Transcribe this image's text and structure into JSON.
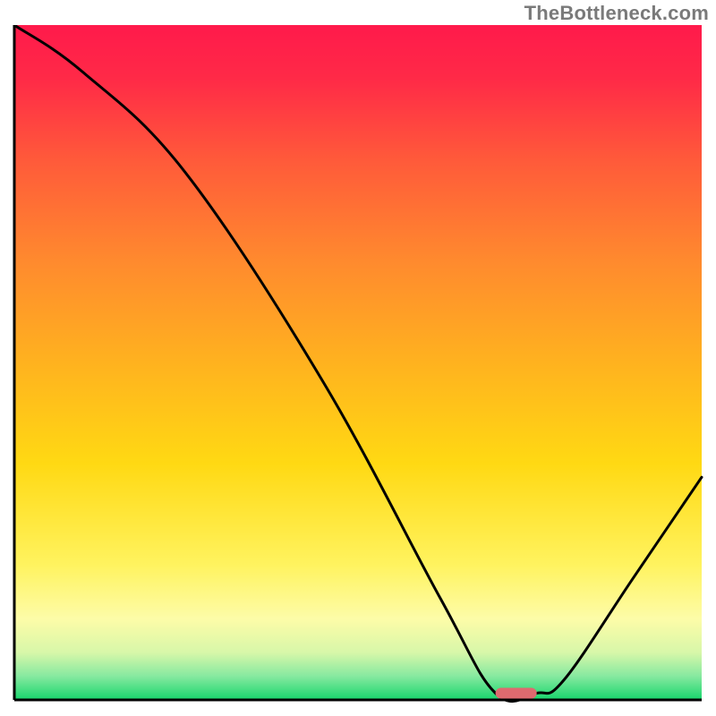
{
  "watermark": "TheBottleneck.com",
  "chart_data": {
    "type": "line",
    "title": "",
    "xlabel": "",
    "ylabel": "",
    "xlim": [
      0,
      100
    ],
    "ylim": [
      0,
      100
    ],
    "grid": false,
    "legend": "none",
    "series": [
      {
        "name": "bottleneck-curve",
        "x": [
          0,
          10,
          25,
          45,
          62,
          70,
          76,
          80,
          90,
          100
        ],
        "y": [
          100,
          93,
          78,
          47,
          15,
          1,
          1,
          3,
          18,
          33
        ]
      }
    ],
    "optimal_zone": {
      "x_start": 70,
      "x_end": 76,
      "y": 1
    },
    "background_gradient": {
      "stops": [
        {
          "pos": 0.0,
          "color": "#ff1a4b"
        },
        {
          "pos": 0.08,
          "color": "#ff2a47"
        },
        {
          "pos": 0.2,
          "color": "#ff5a3a"
        },
        {
          "pos": 0.35,
          "color": "#ff8a2e"
        },
        {
          "pos": 0.5,
          "color": "#ffb21f"
        },
        {
          "pos": 0.65,
          "color": "#ffd913"
        },
        {
          "pos": 0.8,
          "color": "#fff35f"
        },
        {
          "pos": 0.88,
          "color": "#fdfca8"
        },
        {
          "pos": 0.93,
          "color": "#d7f7a9"
        },
        {
          "pos": 0.965,
          "color": "#86e9a0"
        },
        {
          "pos": 1.0,
          "color": "#17d66c"
        }
      ]
    },
    "marker_color": "#de6a6f",
    "curve_color": "#000000",
    "axis_color": "#000000"
  }
}
